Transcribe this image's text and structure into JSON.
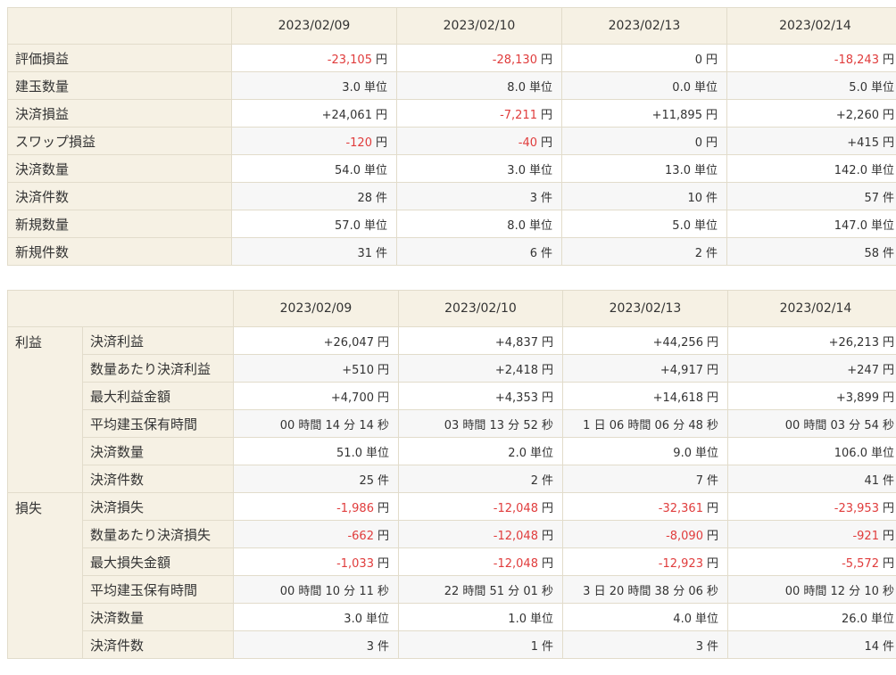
{
  "summary": {
    "dates": [
      "2023/02/09",
      "2023/02/10",
      "2023/02/13",
      "2023/02/14"
    ],
    "rows": [
      {
        "label": "評価損益",
        "cells": [
          {
            "v": "-23,105",
            "u": "円",
            "neg": true
          },
          {
            "v": "-28,130",
            "u": "円",
            "neg": true
          },
          {
            "v": "0",
            "u": "円",
            "neg": false
          },
          {
            "v": "-18,243",
            "u": "円",
            "neg": true
          }
        ]
      },
      {
        "label": "建玉数量",
        "cells": [
          {
            "v": "3.0",
            "u": "単位",
            "neg": false
          },
          {
            "v": "8.0",
            "u": "単位",
            "neg": false
          },
          {
            "v": "0.0",
            "u": "単位",
            "neg": false
          },
          {
            "v": "5.0",
            "u": "単位",
            "neg": false
          }
        ]
      },
      {
        "label": "決済損益",
        "cells": [
          {
            "v": "+24,061",
            "u": "円",
            "neg": false
          },
          {
            "v": "-7,211",
            "u": "円",
            "neg": true
          },
          {
            "v": "+11,895",
            "u": "円",
            "neg": false
          },
          {
            "v": "+2,260",
            "u": "円",
            "neg": false
          }
        ]
      },
      {
        "label": "スワップ損益",
        "cells": [
          {
            "v": "-120",
            "u": "円",
            "neg": true
          },
          {
            "v": "-40",
            "u": "円",
            "neg": true
          },
          {
            "v": "0",
            "u": "円",
            "neg": false
          },
          {
            "v": "+415",
            "u": "円",
            "neg": false
          }
        ]
      },
      {
        "label": "決済数量",
        "cells": [
          {
            "v": "54.0",
            "u": "単位",
            "neg": false
          },
          {
            "v": "3.0",
            "u": "単位",
            "neg": false
          },
          {
            "v": "13.0",
            "u": "単位",
            "neg": false
          },
          {
            "v": "142.0",
            "u": "単位",
            "neg": false
          }
        ]
      },
      {
        "label": "決済件数",
        "cells": [
          {
            "v": "28",
            "u": "件",
            "neg": false
          },
          {
            "v": "3",
            "u": "件",
            "neg": false
          },
          {
            "v": "10",
            "u": "件",
            "neg": false
          },
          {
            "v": "57",
            "u": "件",
            "neg": false
          }
        ]
      },
      {
        "label": "新規数量",
        "cells": [
          {
            "v": "57.0",
            "u": "単位",
            "neg": false
          },
          {
            "v": "8.0",
            "u": "単位",
            "neg": false
          },
          {
            "v": "5.0",
            "u": "単位",
            "neg": false
          },
          {
            "v": "147.0",
            "u": "単位",
            "neg": false
          }
        ]
      },
      {
        "label": "新規件数",
        "cells": [
          {
            "v": "31",
            "u": "件",
            "neg": false
          },
          {
            "v": "6",
            "u": "件",
            "neg": false
          },
          {
            "v": "2",
            "u": "件",
            "neg": false
          },
          {
            "v": "58",
            "u": "件",
            "neg": false
          }
        ]
      }
    ]
  },
  "detail": {
    "dates": [
      "2023/02/09",
      "2023/02/10",
      "2023/02/13",
      "2023/02/14"
    ],
    "groups": [
      {
        "category": "利益",
        "rows": [
          {
            "label": "決済利益",
            "cells": [
              {
                "v": "+26,047",
                "u": "円",
                "neg": false
              },
              {
                "v": "+4,837",
                "u": "円",
                "neg": false
              },
              {
                "v": "+44,256",
                "u": "円",
                "neg": false
              },
              {
                "v": "+26,213",
                "u": "円",
                "neg": false
              }
            ]
          },
          {
            "label": "数量あたり決済利益",
            "cells": [
              {
                "v": "+510",
                "u": "円",
                "neg": false
              },
              {
                "v": "+2,418",
                "u": "円",
                "neg": false
              },
              {
                "v": "+4,917",
                "u": "円",
                "neg": false
              },
              {
                "v": "+247",
                "u": "円",
                "neg": false
              }
            ]
          },
          {
            "label": "最大利益金額",
            "cells": [
              {
                "v": "+4,700",
                "u": "円",
                "neg": false
              },
              {
                "v": "+4,353",
                "u": "円",
                "neg": false
              },
              {
                "v": "+14,618",
                "u": "円",
                "neg": false
              },
              {
                "v": "+3,899",
                "u": "円",
                "neg": false
              }
            ]
          },
          {
            "label": "平均建玉保有時間",
            "cells": [
              {
                "v": "00 時間 14 分 14 秒",
                "u": "",
                "neg": false
              },
              {
                "v": "03 時間 13 分 52 秒",
                "u": "",
                "neg": false
              },
              {
                "v": "1 日 06 時間 06 分 48 秒",
                "u": "",
                "neg": false
              },
              {
                "v": "00 時間 03 分 54 秒",
                "u": "",
                "neg": false
              }
            ]
          },
          {
            "label": "決済数量",
            "cells": [
              {
                "v": "51.0",
                "u": "単位",
                "neg": false
              },
              {
                "v": "2.0",
                "u": "単位",
                "neg": false
              },
              {
                "v": "9.0",
                "u": "単位",
                "neg": false
              },
              {
                "v": "106.0",
                "u": "単位",
                "neg": false
              }
            ]
          },
          {
            "label": "決済件数",
            "cells": [
              {
                "v": "25",
                "u": "件",
                "neg": false
              },
              {
                "v": "2",
                "u": "件",
                "neg": false
              },
              {
                "v": "7",
                "u": "件",
                "neg": false
              },
              {
                "v": "41",
                "u": "件",
                "neg": false
              }
            ]
          }
        ]
      },
      {
        "category": "損失",
        "rows": [
          {
            "label": "決済損失",
            "cells": [
              {
                "v": "-1,986",
                "u": "円",
                "neg": true
              },
              {
                "v": "-12,048",
                "u": "円",
                "neg": true
              },
              {
                "v": "-32,361",
                "u": "円",
                "neg": true
              },
              {
                "v": "-23,953",
                "u": "円",
                "neg": true
              }
            ]
          },
          {
            "label": "数量あたり決済損失",
            "cells": [
              {
                "v": "-662",
                "u": "円",
                "neg": true
              },
              {
                "v": "-12,048",
                "u": "円",
                "neg": true
              },
              {
                "v": "-8,090",
                "u": "円",
                "neg": true
              },
              {
                "v": "-921",
                "u": "円",
                "neg": true
              }
            ]
          },
          {
            "label": "最大損失金額",
            "cells": [
              {
                "v": "-1,033",
                "u": "円",
                "neg": true
              },
              {
                "v": "-12,048",
                "u": "円",
                "neg": true
              },
              {
                "v": "-12,923",
                "u": "円",
                "neg": true
              },
              {
                "v": "-5,572",
                "u": "円",
                "neg": true
              }
            ]
          },
          {
            "label": "平均建玉保有時間",
            "cells": [
              {
                "v": "00 時間 10 分 11 秒",
                "u": "",
                "neg": false
              },
              {
                "v": "22 時間 51 分 01 秒",
                "u": "",
                "neg": false
              },
              {
                "v": "3 日 20 時間 38 分 06 秒",
                "u": "",
                "neg": false
              },
              {
                "v": "00 時間 12 分 10 秒",
                "u": "",
                "neg": false
              }
            ]
          },
          {
            "label": "決済数量",
            "cells": [
              {
                "v": "3.0",
                "u": "単位",
                "neg": false
              },
              {
                "v": "1.0",
                "u": "単位",
                "neg": false
              },
              {
                "v": "4.0",
                "u": "単位",
                "neg": false
              },
              {
                "v": "26.0",
                "u": "単位",
                "neg": false
              }
            ]
          },
          {
            "label": "決済件数",
            "cells": [
              {
                "v": "3",
                "u": "件",
                "neg": false
              },
              {
                "v": "1",
                "u": "件",
                "neg": false
              },
              {
                "v": "3",
                "u": "件",
                "neg": false
              },
              {
                "v": "14",
                "u": "件",
                "neg": false
              }
            ]
          }
        ]
      }
    ]
  }
}
